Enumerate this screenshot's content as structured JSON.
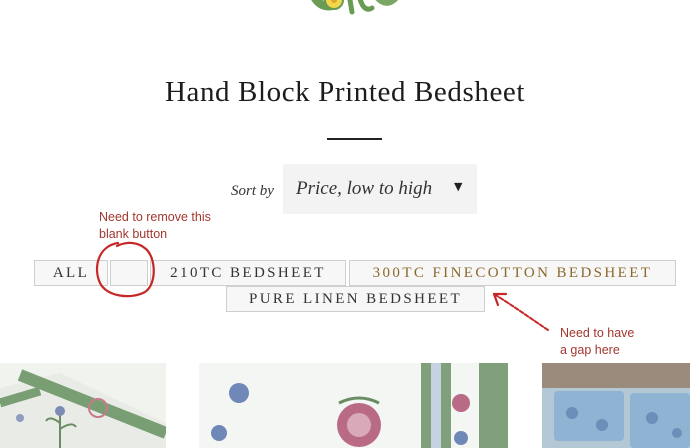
{
  "page": {
    "title": "Hand Block Printed Bedsheet"
  },
  "sort": {
    "label": "Sort by",
    "selected": "Price, low to high",
    "caret_icon": "caret-down-icon"
  },
  "filters": [
    {
      "label": "ALL"
    },
    {
      "label": ""
    },
    {
      "label": "210TC BEDSHEET"
    },
    {
      "label": "300TC FINECOTTON BEDSHEET"
    },
    {
      "label": "PURE LINEN BEDSHEET"
    }
  ],
  "annotations": {
    "remove_blank": [
      "Need to remove this",
      "blank button"
    ],
    "gap": [
      "Need to have",
      "a gap here"
    ],
    "color": "#a3372f"
  },
  "colors": {
    "active_filter": "#8a6a2b",
    "button_bg": "#f7f7f7",
    "select_bg": "#f3f3f3"
  }
}
